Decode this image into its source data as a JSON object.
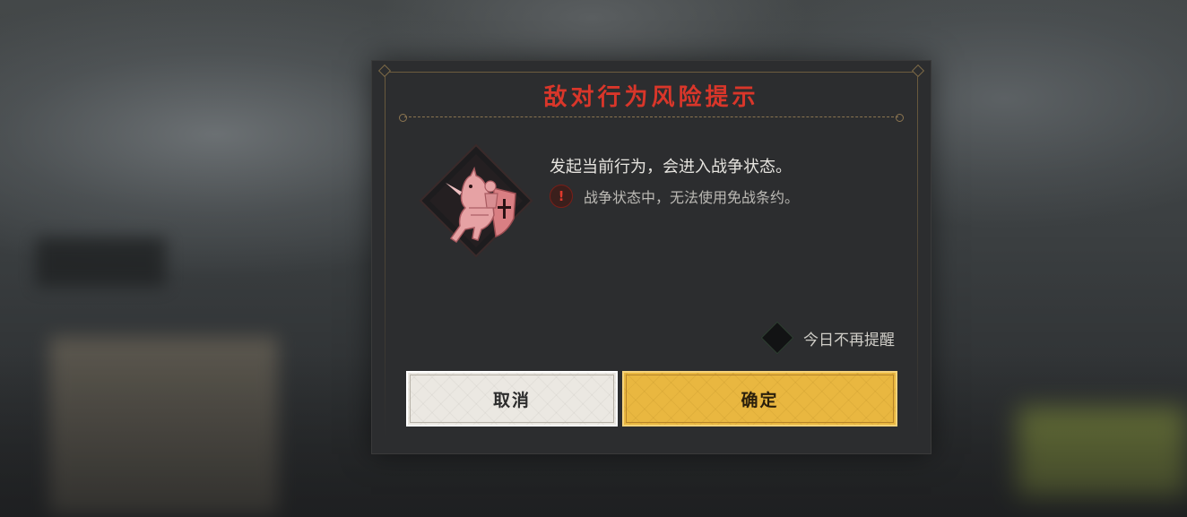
{
  "dialog": {
    "title": "敌对行为风险提示",
    "main_message": "发起当前行为，会进入战争状态。",
    "warning": {
      "icon": "exclamation-icon",
      "text": "战争状态中，无法使用免战条约。"
    },
    "emblem_icon": "knight-on-horse-emblem",
    "dont_remind_label": "今日不再提醒",
    "dont_remind_checked": false,
    "cancel_label": "取消",
    "confirm_label": "确定"
  },
  "colors": {
    "title": "#d9362a",
    "confirm_button": "#e9b740",
    "cancel_button": "#ebe8e2",
    "dialog_bg": "#2c2d2f"
  }
}
